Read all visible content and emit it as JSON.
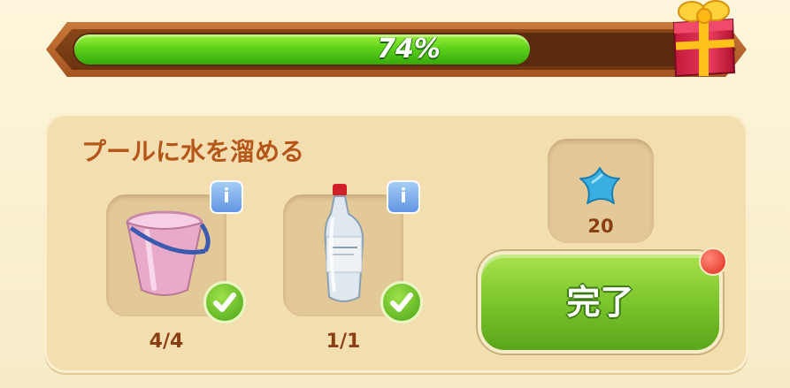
{
  "progress": {
    "percent_label": "74%",
    "fraction": 0.74
  },
  "task": {
    "title": "プールに水を溜める",
    "items": [
      {
        "name": "bucket",
        "count": "4/4",
        "complete": true,
        "info": "i"
      },
      {
        "name": "water-bottle",
        "count": "1/1",
        "complete": true,
        "info": "i"
      }
    ]
  },
  "reward": {
    "icon": "blue-star",
    "value": "20"
  },
  "complete_button": {
    "label": "完了"
  },
  "icons": {
    "gift": "gift-box-icon",
    "check": "checkmark-icon",
    "info": "info-icon"
  },
  "colors": {
    "progress_fill": "#5ed21a",
    "accent_text": "#b5561a",
    "button": "#7cc52c"
  }
}
